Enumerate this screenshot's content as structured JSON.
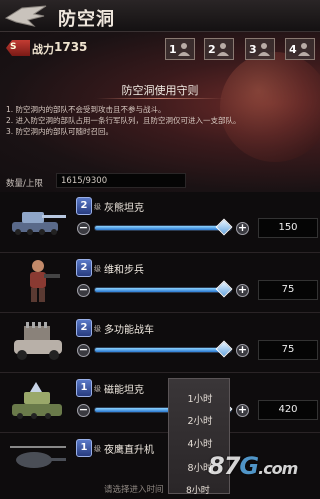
{
  "header": {
    "title": "防空洞"
  },
  "power": {
    "badge": "S",
    "label": "战力",
    "value": "1735"
  },
  "slots": [
    {
      "num": "1"
    },
    {
      "num": "2"
    },
    {
      "num": "3"
    },
    {
      "num": "4"
    }
  ],
  "rules": {
    "title": "防空洞使用守则",
    "items": [
      "1. 防空洞内的部队不会受到攻击且不参与战斗。",
      "2. 进入防空洞的部队占用一条行军队列，且防空洞仅可进入一支部队。",
      "3. 防空洞内的部队可随时召回。"
    ]
  },
  "count": {
    "label": "数量/上限",
    "value": "1615/9300"
  },
  "level_suffix": "级",
  "units": [
    {
      "level": "2",
      "name": "灰熊坦克",
      "value": "150",
      "fill": 0.95
    },
    {
      "level": "2",
      "name": "维和步兵",
      "value": "75",
      "fill": 0.95
    },
    {
      "level": "2",
      "name": "多功能战车",
      "value": "75",
      "fill": 0.95
    },
    {
      "level": "1",
      "name": "磁能坦克",
      "value": "420",
      "fill": 0.95
    },
    {
      "level": "1",
      "name": "夜鹰直升机",
      "value": "",
      "fill": 0.0
    }
  ],
  "dropdown": {
    "options": [
      "1小时",
      "2小时",
      "4小时",
      "8小时"
    ],
    "selected": "8小时"
  },
  "footer": {
    "prompt": "请选择进入时间"
  },
  "watermark": {
    "a": "87",
    "b": "G",
    "c": ".com"
  },
  "colors": {
    "accent": "#2a78d0",
    "power_badge": "#c33c33"
  }
}
